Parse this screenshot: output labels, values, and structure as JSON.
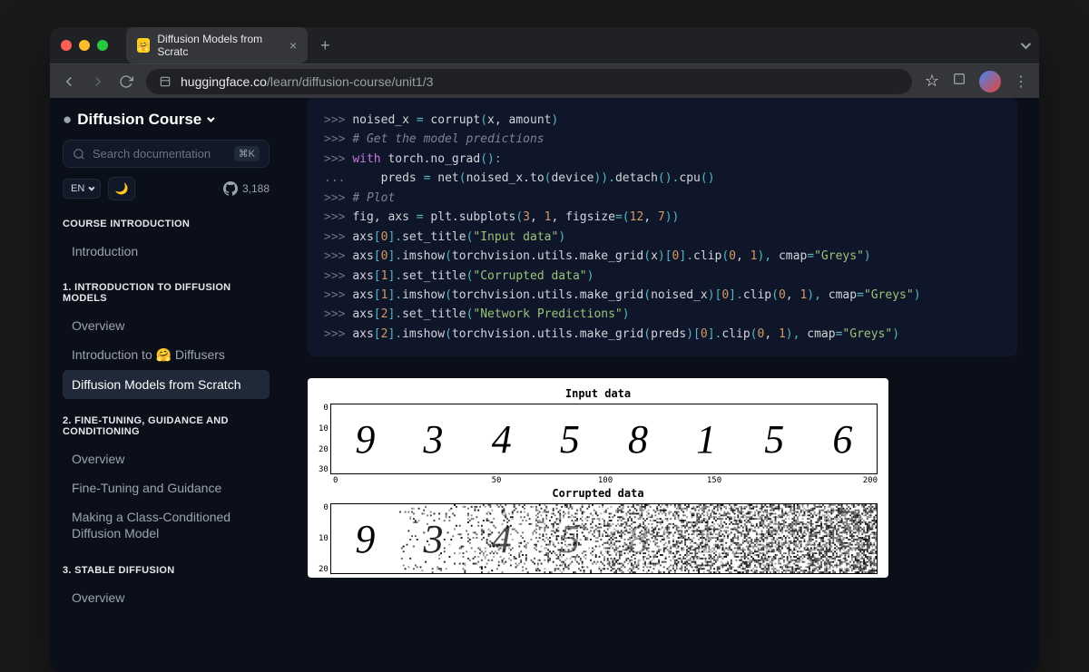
{
  "browser": {
    "tab_title": "Diffusion Models from Scratc",
    "url_domain": "huggingface.co",
    "url_path": "/learn/diffusion-course/unit1/3"
  },
  "sidebar": {
    "course_title": "Diffusion Course",
    "search_placeholder": "Search documentation",
    "search_kbd": "⌘K",
    "lang": "EN",
    "github_stars": "3,188",
    "sections": [
      {
        "header": "COURSE INTRODUCTION",
        "items": [
          "Introduction"
        ],
        "active": -1
      },
      {
        "header": "1. INTRODUCTION TO DIFFUSION MODELS",
        "items": [
          "Overview",
          "Introduction to 🤗 Diffusers",
          "Diffusion Models from Scratch"
        ],
        "active": 2
      },
      {
        "header": "2. FINE-TUNING, GUIDANCE AND CONDITIONING",
        "items": [
          "Overview",
          "Fine-Tuning and Guidance",
          "Making a Class-Conditioned Diffusion Model"
        ],
        "active": -1
      },
      {
        "header": "3. STABLE DIFFUSION",
        "items": [
          "Overview"
        ],
        "active": -1
      }
    ]
  },
  "code": {
    "lines": [
      {
        "prompt": ">>> ",
        "tokens": [
          [
            "noised_x ",
            ""
          ],
          [
            "= ",
            "op"
          ],
          [
            "corrupt",
            ""
          ],
          [
            "(",
            "op"
          ],
          [
            "x, amount",
            ""
          ],
          [
            ")",
            "op"
          ]
        ]
      },
      {
        "prompt": "",
        "tokens": []
      },
      {
        "prompt": ">>> ",
        "tokens": [
          [
            "# Get the model predictions",
            "comment"
          ]
        ]
      },
      {
        "prompt": ">>> ",
        "tokens": [
          [
            "with ",
            "kw"
          ],
          [
            "torch.no_grad",
            ""
          ],
          [
            "():",
            "op"
          ]
        ]
      },
      {
        "prompt": "... ",
        "tokens": [
          [
            "    preds ",
            ""
          ],
          [
            "= ",
            "op"
          ],
          [
            "net",
            ""
          ],
          [
            "(",
            "op"
          ],
          [
            "noised_x.to",
            ""
          ],
          [
            "(",
            "op"
          ],
          [
            "device",
            ""
          ],
          [
            ")).",
            "op"
          ],
          [
            "detach",
            ""
          ],
          [
            "().",
            "op"
          ],
          [
            "cpu",
            ""
          ],
          [
            "()",
            "op"
          ]
        ]
      },
      {
        "prompt": "",
        "tokens": []
      },
      {
        "prompt": ">>> ",
        "tokens": [
          [
            "# Plot",
            "comment"
          ]
        ]
      },
      {
        "prompt": ">>> ",
        "tokens": [
          [
            "fig, axs ",
            ""
          ],
          [
            "= ",
            "op"
          ],
          [
            "plt.subplots",
            ""
          ],
          [
            "(",
            "op"
          ],
          [
            "3",
            "num"
          ],
          [
            ", ",
            ""
          ],
          [
            "1",
            "num"
          ],
          [
            ", figsize",
            ""
          ],
          [
            "=(",
            "op"
          ],
          [
            "12",
            "num"
          ],
          [
            ", ",
            ""
          ],
          [
            "7",
            "num"
          ],
          [
            "))",
            "op"
          ]
        ]
      },
      {
        "prompt": ">>> ",
        "tokens": [
          [
            "axs",
            ""
          ],
          [
            "[",
            "op"
          ],
          [
            "0",
            "num"
          ],
          [
            "].",
            "op"
          ],
          [
            "set_title",
            ""
          ],
          [
            "(",
            "op"
          ],
          [
            "\"Input data\"",
            "str"
          ],
          [
            ")",
            "op"
          ]
        ]
      },
      {
        "prompt": ">>> ",
        "tokens": [
          [
            "axs",
            ""
          ],
          [
            "[",
            "op"
          ],
          [
            "0",
            "num"
          ],
          [
            "].",
            "op"
          ],
          [
            "imshow",
            ""
          ],
          [
            "(",
            "op"
          ],
          [
            "torchvision.utils.make_grid",
            ""
          ],
          [
            "(",
            "op"
          ],
          [
            "x",
            ""
          ],
          [
            ")[",
            "op"
          ],
          [
            "0",
            "num"
          ],
          [
            "].",
            "op"
          ],
          [
            "clip",
            ""
          ],
          [
            "(",
            "op"
          ],
          [
            "0",
            "num"
          ],
          [
            ", ",
            ""
          ],
          [
            "1",
            "num"
          ],
          [
            "), ",
            "op"
          ],
          [
            "cmap",
            ""
          ],
          [
            "=",
            "op"
          ],
          [
            "\"Greys\"",
            "str"
          ],
          [
            ")",
            "op"
          ]
        ]
      },
      {
        "prompt": ">>> ",
        "tokens": [
          [
            "axs",
            ""
          ],
          [
            "[",
            "op"
          ],
          [
            "1",
            "num"
          ],
          [
            "].",
            "op"
          ],
          [
            "set_title",
            ""
          ],
          [
            "(",
            "op"
          ],
          [
            "\"Corrupted data\"",
            "str"
          ],
          [
            ")",
            "op"
          ]
        ]
      },
      {
        "prompt": ">>> ",
        "tokens": [
          [
            "axs",
            ""
          ],
          [
            "[",
            "op"
          ],
          [
            "1",
            "num"
          ],
          [
            "].",
            "op"
          ],
          [
            "imshow",
            ""
          ],
          [
            "(",
            "op"
          ],
          [
            "torchvision.utils.make_grid",
            ""
          ],
          [
            "(",
            "op"
          ],
          [
            "noised_x",
            ""
          ],
          [
            ")[",
            "op"
          ],
          [
            "0",
            "num"
          ],
          [
            "].",
            "op"
          ],
          [
            "clip",
            ""
          ],
          [
            "(",
            "op"
          ],
          [
            "0",
            "num"
          ],
          [
            ", ",
            ""
          ],
          [
            "1",
            "num"
          ],
          [
            "), ",
            "op"
          ],
          [
            "cmap",
            ""
          ],
          [
            "=",
            "op"
          ],
          [
            "\"Greys\"",
            "str"
          ],
          [
            ")",
            "op"
          ]
        ]
      },
      {
        "prompt": ">>> ",
        "tokens": [
          [
            "axs",
            ""
          ],
          [
            "[",
            "op"
          ],
          [
            "2",
            "num"
          ],
          [
            "].",
            "op"
          ],
          [
            "set_title",
            ""
          ],
          [
            "(",
            "op"
          ],
          [
            "\"Network Predictions\"",
            "str"
          ],
          [
            ")",
            "op"
          ]
        ]
      },
      {
        "prompt": ">>> ",
        "tokens": [
          [
            "axs",
            ""
          ],
          [
            "[",
            "op"
          ],
          [
            "2",
            "num"
          ],
          [
            "].",
            "op"
          ],
          [
            "imshow",
            ""
          ],
          [
            "(",
            "op"
          ],
          [
            "torchvision.utils.make_grid",
            ""
          ],
          [
            "(",
            "op"
          ],
          [
            "preds",
            ""
          ],
          [
            ")[",
            "op"
          ],
          [
            "0",
            "num"
          ],
          [
            "].",
            "op"
          ],
          [
            "clip",
            ""
          ],
          [
            "(",
            "op"
          ],
          [
            "0",
            "num"
          ],
          [
            ", ",
            ""
          ],
          [
            "1",
            "num"
          ],
          [
            "), ",
            "op"
          ],
          [
            "cmap",
            ""
          ],
          [
            "=",
            "op"
          ],
          [
            "\"Greys\"",
            "str"
          ],
          [
            ")",
            "op"
          ]
        ]
      }
    ]
  },
  "chart_data": [
    {
      "type": "image_grid",
      "title": "Input data",
      "yticks": [
        0,
        10,
        20,
        30
      ],
      "xticks": [
        0,
        50,
        100,
        150,
        200
      ],
      "digits": [
        "9",
        "3",
        "4",
        "5",
        "8",
        "1",
        "5",
        "6"
      ]
    },
    {
      "type": "image_grid",
      "title": "Corrupted data",
      "yticks": [
        0,
        10,
        20
      ],
      "digits": [
        "9",
        "3",
        "4",
        "5",
        "8",
        "1",
        "5",
        "6"
      ],
      "noise_levels": [
        0.0,
        0.14,
        0.28,
        0.42,
        0.56,
        0.7,
        0.84,
        0.98
      ]
    }
  ]
}
